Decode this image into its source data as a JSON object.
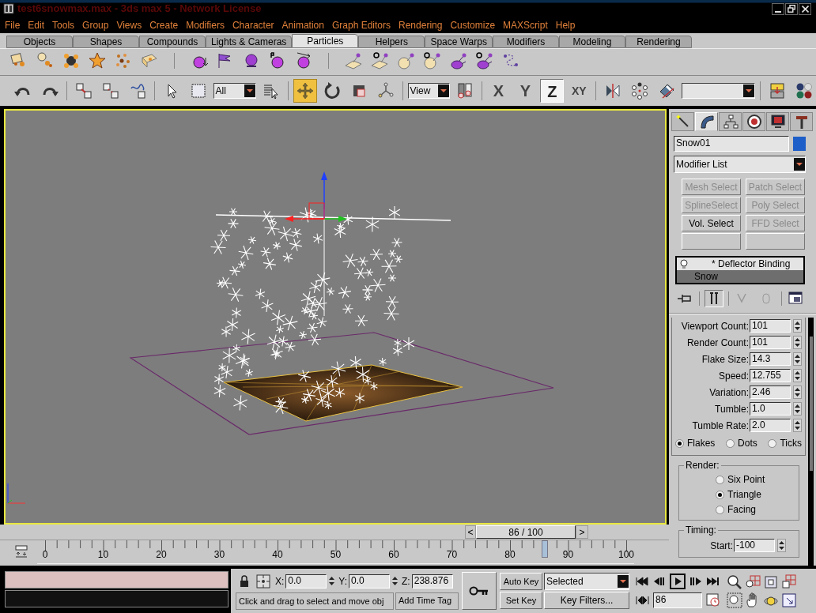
{
  "window": {
    "title": "test6snowmax.max - 3ds max 5 - Network License"
  },
  "menus": [
    "File",
    "Edit",
    "Tools",
    "Group",
    "Views",
    "Create",
    "Modifiers",
    "Character",
    "Animation",
    "Graph Editors",
    "Rendering",
    "Customize",
    "MAXScript",
    "Help"
  ],
  "tabs": [
    {
      "label": "Objects",
      "selected": false
    },
    {
      "label": "Shapes",
      "selected": false
    },
    {
      "label": "Compounds",
      "selected": false
    },
    {
      "label": "Lights & Cameras",
      "selected": false
    },
    {
      "label": "Particles",
      "selected": true
    },
    {
      "label": "Helpers",
      "selected": false
    },
    {
      "label": "Space Warps",
      "selected": false
    },
    {
      "label": "Modifiers",
      "selected": false
    },
    {
      "label": "Modeling",
      "selected": false
    },
    {
      "label": "Rendering",
      "selected": false
    }
  ],
  "toolbar": {
    "selection_filter": "All",
    "reference_coordinates": "View",
    "axes": [
      {
        "label": "X",
        "selected": false
      },
      {
        "label": "Y",
        "selected": false
      },
      {
        "label": "Z",
        "selected": true
      },
      {
        "label": "XY",
        "selected": false
      }
    ]
  },
  "command_panel": {
    "tabs": [
      {
        "selected": false
      },
      {
        "selected": true
      },
      {
        "selected": false
      },
      {
        "selected": false
      },
      {
        "selected": false
      },
      {
        "selected": false
      }
    ],
    "object_name": "Snow01",
    "modifier_list": "Modifier List",
    "modifier_buttons": [
      {
        "label": "Mesh Select",
        "disabled": true
      },
      {
        "label": "Patch Select",
        "disabled": true
      },
      {
        "label": "SplineSelect",
        "disabled": true
      },
      {
        "label": "Poly Select",
        "disabled": true
      },
      {
        "label": "Vol. Select",
        "disabled": false
      },
      {
        "label": "FFD Select",
        "disabled": true
      }
    ],
    "stack": [
      {
        "label": "* Deflector Binding",
        "selected": false
      },
      {
        "label": "Snow",
        "selected": true
      }
    ],
    "parameters": [
      {
        "label": "Viewport Count:",
        "value": "101"
      },
      {
        "label": "Render Count:",
        "value": "101"
      },
      {
        "label": "Flake Size:",
        "value": "14.3"
      },
      {
        "label": "Speed:",
        "value": "12.755"
      },
      {
        "label": "Variation:",
        "value": "2.46"
      },
      {
        "label": "Tumble:",
        "value": "1.0"
      },
      {
        "label": "Tumble Rate:",
        "value": "2.0"
      }
    ],
    "display": [
      {
        "label": "Flakes",
        "selected": true
      },
      {
        "label": "Dots",
        "selected": false
      },
      {
        "label": "Ticks",
        "selected": false
      }
    ],
    "render": {
      "title": "Render:",
      "options": [
        {
          "label": "Six Point",
          "selected": false
        },
        {
          "label": "Triangle",
          "selected": true
        },
        {
          "label": "Facing",
          "selected": false
        }
      ]
    },
    "timing": {
      "title": "Timing:",
      "label": "Start:",
      "value": "-100"
    }
  },
  "time_slider": {
    "label": "86 / 100",
    "previous": "<",
    "next": ">",
    "level": 0.86
  },
  "timeline": {
    "labels": [
      "0",
      "10",
      "20",
      "30",
      "40",
      "50",
      "60",
      "70",
      "80",
      "90",
      "100"
    ]
  },
  "status": {
    "coordinates": [
      {
        "label": "X:",
        "value": "0.0"
      },
      {
        "label": "Y:",
        "value": "0.0"
      },
      {
        "label": "Z:",
        "value": "238.876"
      }
    ],
    "prompt": "Click and drag to select and move obj",
    "time_tag": "Add Time Tag",
    "auto_key": "Auto Key",
    "set_key": "Set Key",
    "key_mode": "Selected",
    "key_filters": "Key Filters...",
    "frame": "86"
  }
}
